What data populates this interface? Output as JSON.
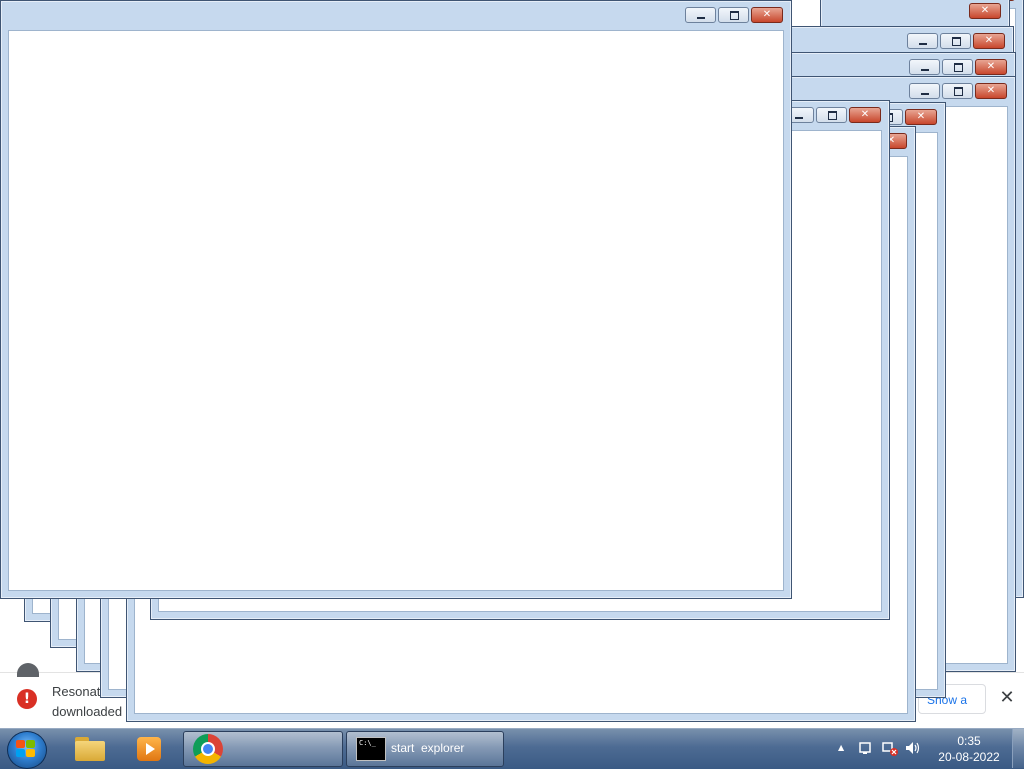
{
  "download_bar": {
    "filename_line1": "Resonate",
    "filename_line2": "downloaded",
    "show_all_label": "Show a",
    "close_glyph": "✕",
    "error_glyph": "!"
  },
  "windows": [
    {
      "title": ""
    },
    {
      "title": ""
    },
    {
      "title": ""
    },
    {
      "title": ""
    },
    {
      "title": ""
    },
    {
      "title": ""
    },
    {
      "title": ""
    },
    {
      "title": ""
    },
    {
      "title": ""
    },
    {
      "title": ""
    }
  ],
  "taskbar": {
    "cmd_window_label": "start  explorer",
    "cmd_prompt_glyph": "C:\\_",
    "pinned": [
      "windows-explorer",
      "windows-media-player",
      "google-chrome"
    ],
    "tray_arrow": "▲",
    "clock_time": "0:35",
    "clock_date": "20-08-2022"
  },
  "colors": {
    "taskbar": "#4d6b93",
    "window_frame": "#c6d9ee",
    "close_button": "#c8472d",
    "error_red": "#d93025"
  }
}
